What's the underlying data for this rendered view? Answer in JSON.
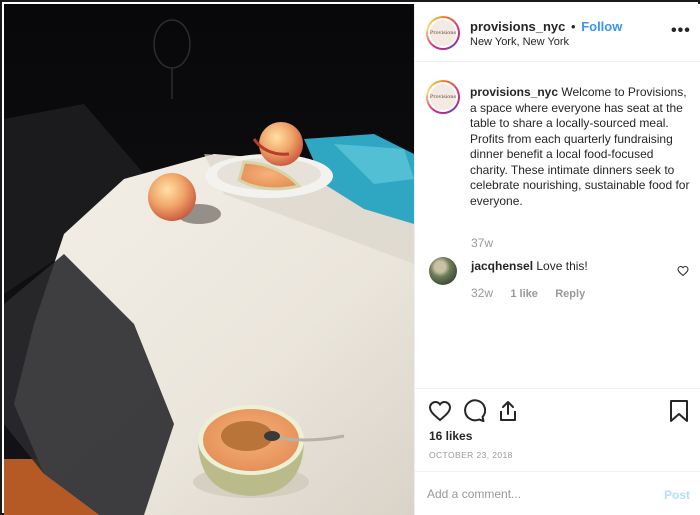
{
  "post": {
    "username": "provisions_nyc",
    "separator": "•",
    "follow_label": "Follow",
    "location": "New York, New York",
    "more_icon": "more-horizontal-icon",
    "avatar_text": "Provisions",
    "image_alt": "Peaches and melon on a table with white tablecloth in sunlight"
  },
  "caption": {
    "username": "provisions_nyc",
    "text": "Welcome to Provisions, a space where everyone has seat at the table to share a locally-sourced meal. Profits from each quarterly fundraising dinner benefit a local food-focused charity. These intimate dinners seek to celebrate nourishing, sustainable food for everyone.",
    "time": "37w"
  },
  "comments": [
    {
      "username": "jacqhensel",
      "text": "Love this!",
      "time": "32w",
      "likes": "1 like",
      "reply_label": "Reply"
    }
  ],
  "actions": {
    "like_icon": "heart-icon",
    "comment_icon": "comment-icon",
    "share_icon": "share-icon",
    "save_icon": "bookmark-icon"
  },
  "likes": "16 likes",
  "date": "OCTOBER 23, 2018",
  "add_comment": {
    "placeholder": "Add a comment...",
    "post_label": "Post"
  },
  "colors": {
    "accent": "#3897f0",
    "post_disabled": "#b2dffc",
    "muted": "#999999"
  }
}
